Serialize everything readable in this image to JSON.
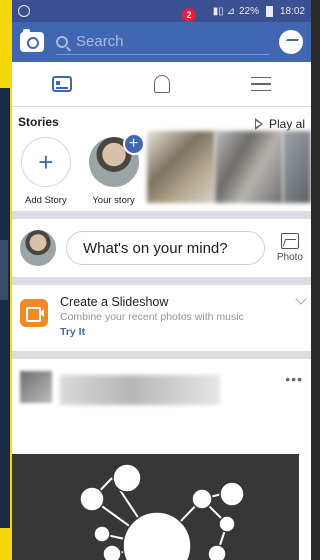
{
  "status_bar": {
    "battery": "22%",
    "time": "18:02"
  },
  "search": {
    "placeholder": "Search"
  },
  "tabs": {
    "notifications_count": "2"
  },
  "stories": {
    "title": "Stories",
    "play_all": "Play al",
    "add_story": "Add Story",
    "your_story": "Your story"
  },
  "composer": {
    "prompt": "What's on your mind?",
    "photo": "Photo"
  },
  "slideshow": {
    "title": "Create a Slideshow",
    "subtitle": "Combine your recent photos with music",
    "cta": "Try It"
  },
  "colors": {
    "brand": "#4267b2",
    "badge": "#e41e3f",
    "slideshow_icon": "#f08a24",
    "frame": "#f5d90a"
  }
}
